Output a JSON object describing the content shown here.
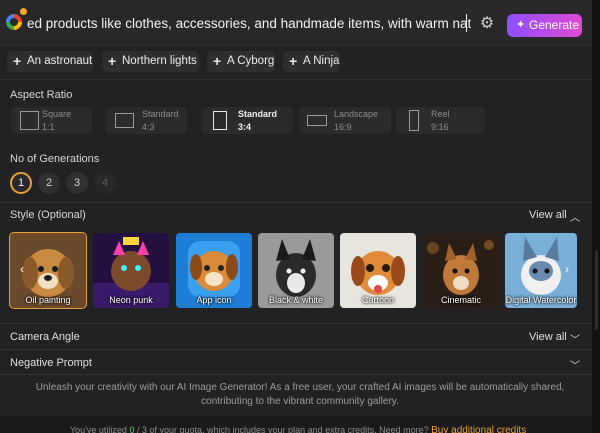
{
  "prompt": {
    "text": "ed products like clothes, accessories, and handmade items, with warm natural lighting",
    "generate_label": "Generate"
  },
  "suggestions": [
    "An astronaut",
    "Northern lights",
    "A Cyborg",
    "A Ninja"
  ],
  "aspect_ratio": {
    "heading": "Aspect Ratio",
    "options": [
      {
        "name": "Square",
        "ratio": "1:1"
      },
      {
        "name": "Standard",
        "ratio": "4:3"
      },
      {
        "name": "Standard",
        "ratio": "3:4"
      },
      {
        "name": "Landscape",
        "ratio": "16:9"
      },
      {
        "name": "Reel",
        "ratio": "9:16"
      }
    ],
    "selected_index": 2
  },
  "generations": {
    "heading": "No of Generations",
    "options": [
      "1",
      "2",
      "3",
      "4"
    ],
    "selected": "1"
  },
  "style": {
    "heading": "Style (Optional)",
    "view_all": "View all",
    "cards": [
      "Oil painting",
      "Neon punk",
      "App icon",
      "Black & white",
      "Cartoon",
      "Cinematic",
      "Digital Watercolor"
    ]
  },
  "camera_angle": {
    "label": "Camera Angle",
    "view_all": "View all"
  },
  "negative_prompt": {
    "label": "Negative Prompt"
  },
  "info_text": "Unleash your creativity with our AI Image Generator! As a free user, your crafted AI images will be automatically shared, contributing to the vibrant community gallery.",
  "footer": {
    "prefix": "You've utilized ",
    "used": "0",
    "separator": " / ",
    "total": "3",
    "suffix": " of your quota, which includes your plan and extra credits. Need more? ",
    "link": "Buy additional credits"
  },
  "colors": {
    "accent": "#e6a234",
    "generate_gradient_start": "#8e4dff",
    "generate_gradient_end": "#e04cd0",
    "panel": "#222224"
  },
  "icons": [
    "google-gemini-icon",
    "settings-gear-icon",
    "sparkle-icon",
    "plus-icon",
    "chevron-up-icon",
    "chevron-down-icon",
    "chevron-left-icon",
    "chevron-right-icon"
  ]
}
